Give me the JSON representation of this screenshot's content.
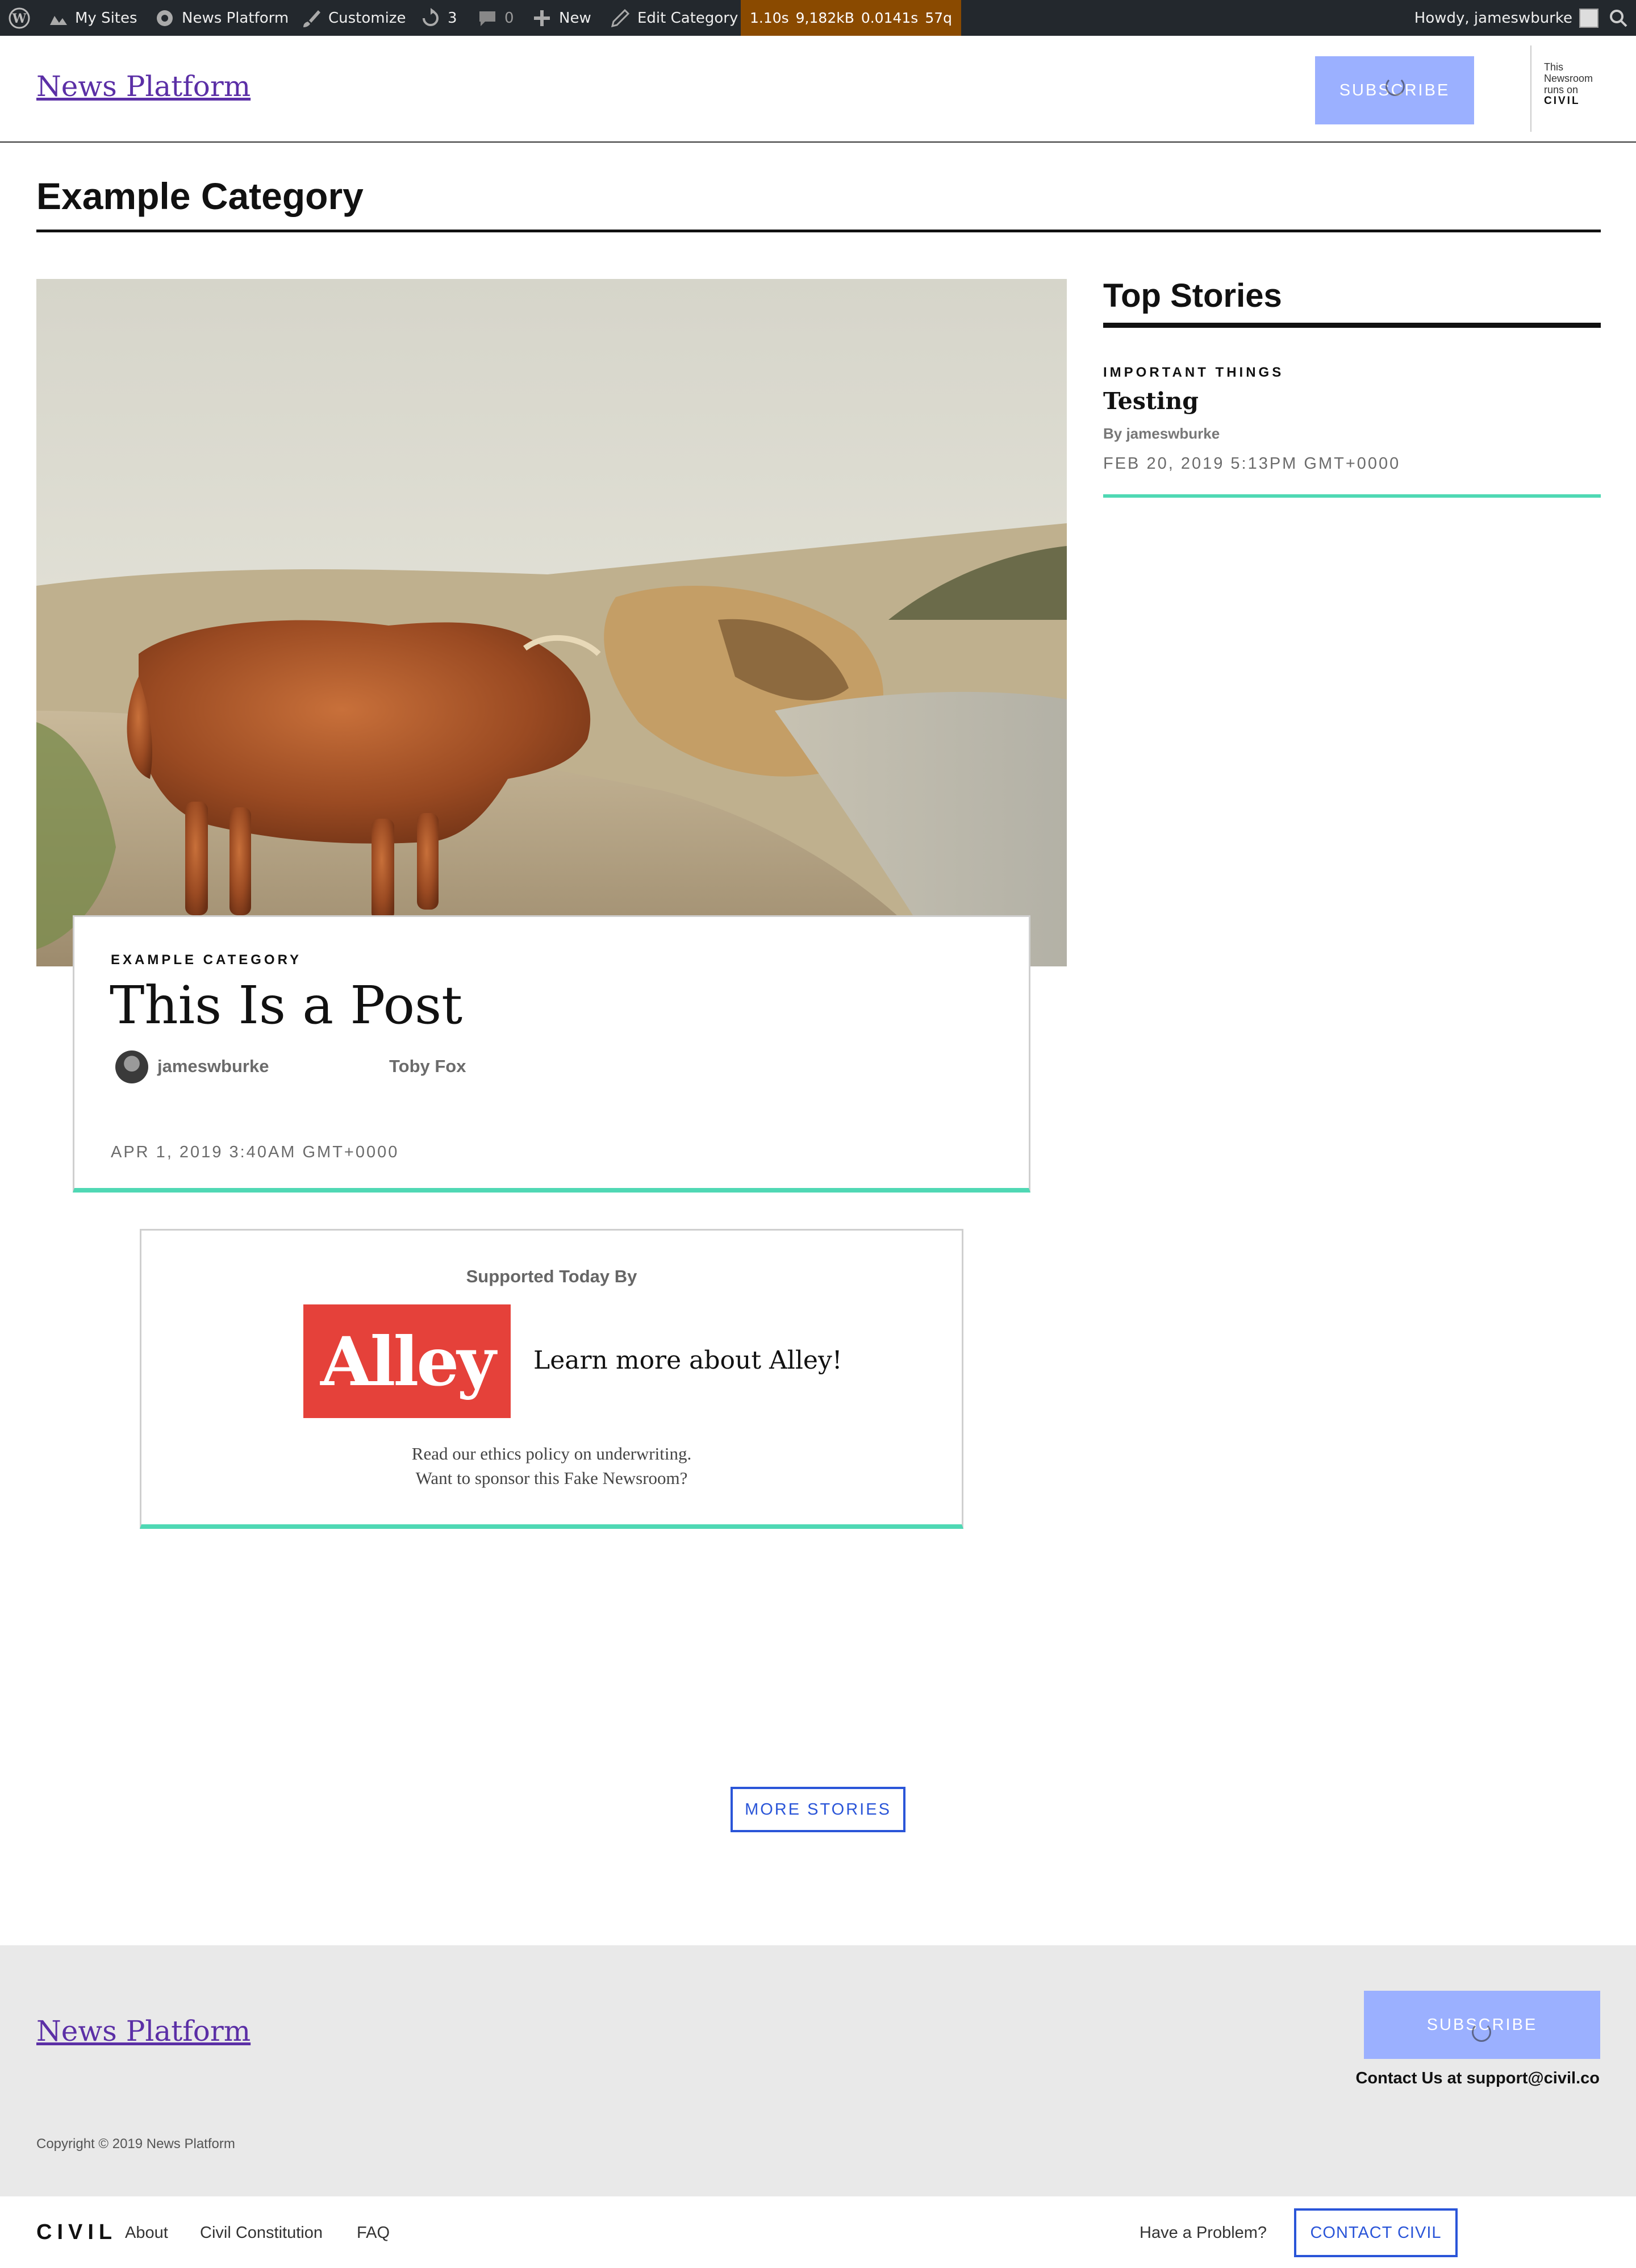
{
  "admin_bar": {
    "wp_logo_icon": "wordpress-icon",
    "my_sites": "My Sites",
    "site_name": "News Platform",
    "customize": "Customize",
    "updates_count": "3",
    "comments_count": "0",
    "new_label": "New",
    "edit_label": "Edit Category",
    "perf": {
      "time": "1.10s",
      "memory": "9,182kB",
      "query_time": "0.0141s",
      "queries": "57q"
    },
    "howdy": "Howdy, jameswburke"
  },
  "header": {
    "site_title": "News Platform",
    "subscribe": "SUBSCRIBE",
    "civil_runs": {
      "line1": "This",
      "line2": "Newsroom",
      "line3": "runs on",
      "brand": "CIVIL"
    }
  },
  "category": {
    "title": "Example Category"
  },
  "featured": {
    "kicker": "EXAMPLE CATEGORY",
    "title": "This Is a Post",
    "author": "jameswburke",
    "coauthor": "Toby Fox",
    "date": "APR 1, 2019 3:40AM GMT+0000"
  },
  "sponsor": {
    "label": "Supported Today By",
    "logo_text": "Alley",
    "cta": "Learn more about Alley!",
    "line1": "Read our ethics policy on underwriting.",
    "line2": "Want to sponsor this Fake Newsroom?"
  },
  "top_stories": {
    "title": "Top Stories",
    "items": [
      {
        "kicker": "IMPORTANT THINGS",
        "headline": "Testing",
        "byline": "By jameswburke",
        "date": "FEB 20, 2019 5:13PM GMT+0000"
      }
    ]
  },
  "more_stories": "MORE STORIES",
  "footer": {
    "site_title": "News Platform",
    "subscribe": "SUBSCRIBE",
    "contact": "Contact Us at support@civil.co",
    "copyright": "Copyright © 2019 News Platform"
  },
  "civil_bar": {
    "logo": "CIVIL",
    "links": [
      "About",
      "Civil Constitution",
      "FAQ"
    ],
    "problem": "Have a Problem?",
    "contact": "CONTACT CIVIL"
  },
  "colors": {
    "accent_teal": "#4fd8b4",
    "subscribe_blue": "#9bb0ff",
    "link_blue": "#2a55d8",
    "alley_red": "#e5413a",
    "admin_bar": "#23282d"
  }
}
